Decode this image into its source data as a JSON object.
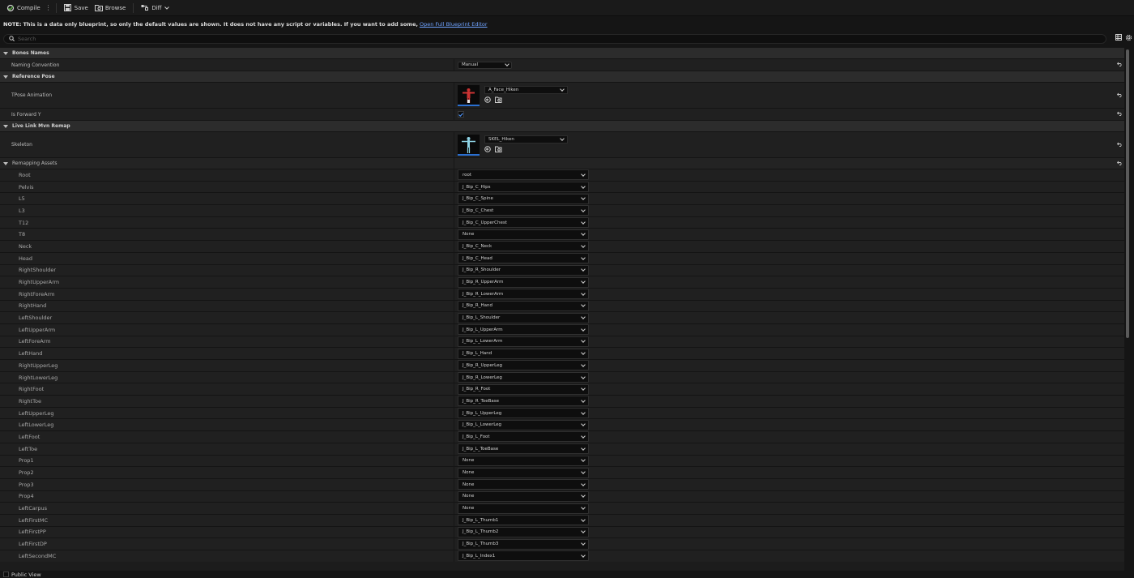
{
  "toolbar": {
    "compile": "Compile",
    "save": "Save",
    "browse": "Browse",
    "diff": "Diff"
  },
  "note": {
    "prefix": "NOTE:",
    "text": "This is a data only blueprint, so only the default values are shown.  It does not have any script or variables.  If you want to add some,",
    "link": "Open Full Blueprint Editor"
  },
  "search": {
    "placeholder": "Search"
  },
  "sections": {
    "bones_names": {
      "title": "Bones Names",
      "naming_convention_label": "Naming Convention",
      "naming_convention_value": "Manual"
    },
    "reference_pose": {
      "title": "Reference Pose",
      "tpose_label": "TPose Animation",
      "tpose_asset": "A_Face_Hiken",
      "is_forward_y_label": "Is Forward Y",
      "is_forward_y_checked": true
    },
    "live_link": {
      "title": "Live Link Mvn Remap",
      "skeleton_label": "Skeleton",
      "skeleton_asset": "SKEL_Hiken"
    },
    "remapping": {
      "title": "Remapping Assets",
      "rows": [
        {
          "bone": "Root",
          "value": "root"
        },
        {
          "bone": "Pelvis",
          "value": "J_Bip_C_Hips"
        },
        {
          "bone": "L5",
          "value": "J_Bip_C_Spine"
        },
        {
          "bone": "L3",
          "value": "J_Bip_C_Chest"
        },
        {
          "bone": "T12",
          "value": "J_Bip_C_UpperChest"
        },
        {
          "bone": "T8",
          "value": "None"
        },
        {
          "bone": "Neck",
          "value": "J_Bip_C_Neck"
        },
        {
          "bone": "Head",
          "value": "J_Bip_C_Head"
        },
        {
          "bone": "RightShoulder",
          "value": "J_Bip_R_Shoulder"
        },
        {
          "bone": "RightUpperArm",
          "value": "J_Bip_R_UpperArm"
        },
        {
          "bone": "RightForeArm",
          "value": "J_Bip_R_LowerArm"
        },
        {
          "bone": "RightHand",
          "value": "J_Bip_R_Hand"
        },
        {
          "bone": "LeftShoulder",
          "value": "J_Bip_L_Shoulder"
        },
        {
          "bone": "LeftUpperArm",
          "value": "J_Bip_L_UpperArm"
        },
        {
          "bone": "LeftForeArm",
          "value": "J_Bip_L_LowerArm"
        },
        {
          "bone": "LeftHand",
          "value": "J_Bip_L_Hand"
        },
        {
          "bone": "RightUpperLeg",
          "value": "J_Bip_R_UpperLeg"
        },
        {
          "bone": "RightLowerLeg",
          "value": "J_Bip_R_LowerLeg"
        },
        {
          "bone": "RightFoot",
          "value": "J_Bip_R_Foot"
        },
        {
          "bone": "RightToe",
          "value": "J_Bip_R_ToeBase"
        },
        {
          "bone": "LeftUpperLeg",
          "value": "J_Bip_L_UpperLeg"
        },
        {
          "bone": "LeftLowerLeg",
          "value": "J_Bip_L_LowerLeg"
        },
        {
          "bone": "LeftFoot",
          "value": "J_Bip_L_Foot"
        },
        {
          "bone": "LeftToe",
          "value": "J_Bip_L_ToeBase"
        },
        {
          "bone": "Prop1",
          "value": "None"
        },
        {
          "bone": "Prop2",
          "value": "None"
        },
        {
          "bone": "Prop3",
          "value": "None"
        },
        {
          "bone": "Prop4",
          "value": "None"
        },
        {
          "bone": "LeftCarpus",
          "value": "None"
        },
        {
          "bone": "LeftFirstMC",
          "value": "J_Bip_L_Thumb1"
        },
        {
          "bone": "LeftFirstPP",
          "value": "J_Bip_L_Thumb2"
        },
        {
          "bone": "LeftFirstDP",
          "value": "J_Bip_L_Thumb3"
        },
        {
          "bone": "LeftSecondMC",
          "value": "J_Bip_L_Index1"
        }
      ]
    }
  },
  "statusbar": {
    "label": "Public View"
  },
  "colors": {
    "accent": "#2a6fd1",
    "link": "#6fa3ff",
    "compile_ok": "#5fb04a"
  }
}
